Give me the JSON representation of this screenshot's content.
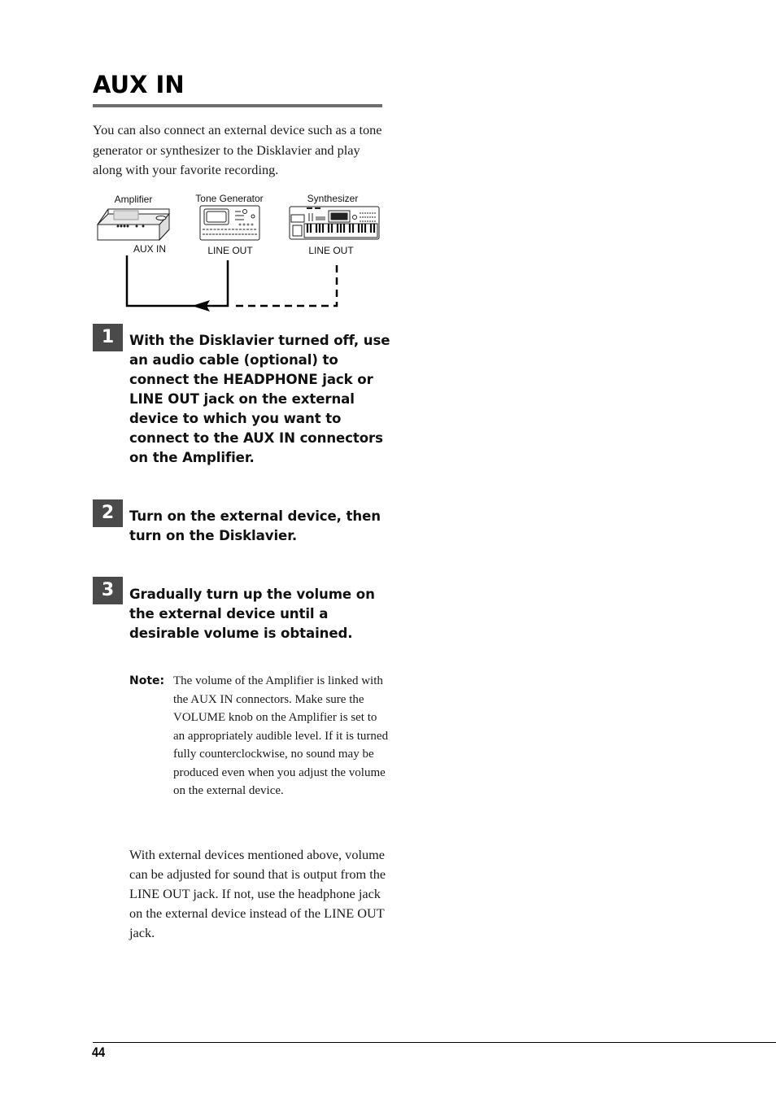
{
  "page": {
    "title": "AUX IN",
    "intro": "You can also connect an external device such as a tone generator or synthesizer to the Disklavier and play along with your favorite recording.",
    "diagram": {
      "devices": [
        {
          "name": "Amplifier",
          "port": "AUX IN"
        },
        {
          "name": "Tone Generator",
          "port": "LINE OUT"
        },
        {
          "name": "Synthesizer",
          "port": "LINE OUT"
        }
      ]
    },
    "steps": [
      {
        "number": "1",
        "text": "With the Disklavier turned off, use an audio cable (optional) to connect the HEADPHONE jack or LINE OUT jack on the external device to which you want to connect to the AUX IN connectors on the Amplifier."
      },
      {
        "number": "2",
        "text": "Turn on the external device, then turn on the Disklavier."
      },
      {
        "number": "3",
        "text": "Gradually turn up the volume on the external device until a desirable volume is obtained."
      }
    ],
    "note": {
      "label": "Note:",
      "text": "The volume of the Amplifier is linked with the AUX IN connectors.  Make sure the VOLUME knob on the Amplifier is set to an appropriately audible level.  If it is turned fully counterclockwise, no sound may be produced even when you adjust the volume on the external device."
    },
    "closing": "With external devices mentioned above, volume can be adjusted for sound that is output from the LINE OUT jack. If not, use the headphone jack on the external device instead of the LINE OUT jack.",
    "page_number": "44"
  }
}
